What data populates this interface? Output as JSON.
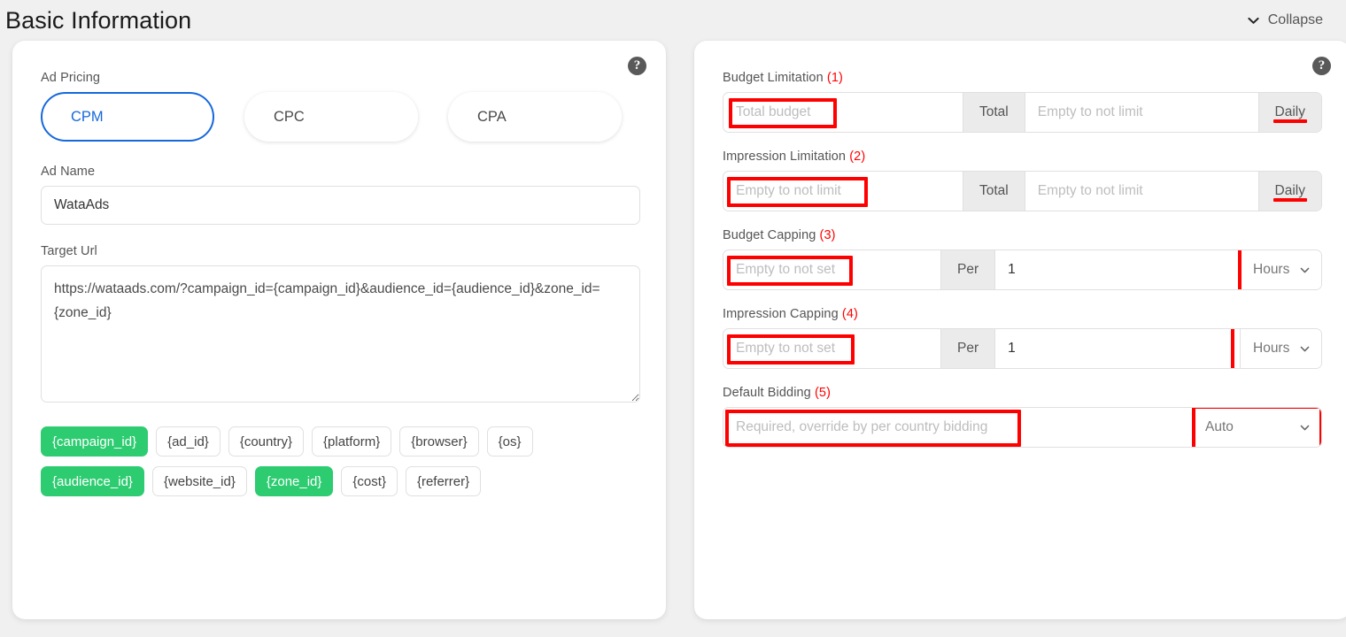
{
  "header": {
    "title": "Basic Information",
    "collapse_label": "Collapse",
    "collapse_icon": "chevron-down-icon"
  },
  "left_panel": {
    "help_icon": "question-mark-icon",
    "help_glyph": "?",
    "ad_pricing": {
      "label": "Ad Pricing",
      "options": [
        {
          "label": "CPM",
          "selected": true
        },
        {
          "label": "CPC",
          "selected": false
        },
        {
          "label": "CPA",
          "selected": false
        }
      ]
    },
    "ad_name": {
      "label": "Ad Name",
      "value": "WataAds",
      "placeholder": "Ad Name"
    },
    "target_url": {
      "label": "Target Url",
      "value": "https://wataads.com/?campaign_id={campaign_id}&audience_id={audience_id}&zone_id={zone_id}",
      "placeholder": "Target Url"
    },
    "macros_row1": [
      {
        "label": "{campaign_id}",
        "active": true
      },
      {
        "label": "{ad_id}",
        "active": false
      },
      {
        "label": "{country}",
        "active": false
      },
      {
        "label": "{platform}",
        "active": false
      },
      {
        "label": "{browser}",
        "active": false
      },
      {
        "label": "{os}",
        "active": false
      }
    ],
    "macros_row2": [
      {
        "label": "{audience_id}",
        "active": true
      },
      {
        "label": "{website_id}",
        "active": false
      },
      {
        "label": "{zone_id}",
        "active": true
      },
      {
        "label": "{cost}",
        "active": false
      },
      {
        "label": "{referrer}",
        "active": false
      }
    ]
  },
  "right_panel": {
    "help_icon": "question-mark-icon",
    "help_glyph": "?",
    "budget_limitation": {
      "label": "Budget Limitation",
      "number": "(1)",
      "total_placeholder": "Total budget",
      "total_value": "",
      "total_addon": "Total",
      "daily_placeholder": "Empty to not limit",
      "daily_value": "",
      "daily_addon": "Daily"
    },
    "impression_limitation": {
      "label": "Impression Limitation",
      "number": "(2)",
      "total_placeholder": "Empty to not limit",
      "total_value": "",
      "total_addon": "Total",
      "daily_placeholder": "Empty to not limit",
      "daily_value": "",
      "daily_addon": "Daily"
    },
    "budget_capping": {
      "label": "Budget Capping",
      "number": "(3)",
      "amount_placeholder": "Empty to not set",
      "amount_value": "",
      "per_addon": "Per",
      "interval_value": "1",
      "interval_placeholder": "1",
      "unit_selected": "Hours"
    },
    "impression_capping": {
      "label": "Impression Capping",
      "number": "(4)",
      "amount_placeholder": "Empty to not set",
      "amount_value": "",
      "per_addon": "Per",
      "interval_value": "1",
      "interval_placeholder": "1",
      "unit_selected": "Hours"
    },
    "default_bidding": {
      "label": "Default Bidding",
      "number": "(5)",
      "bid_placeholder": "Required, override by per country bidding",
      "bid_value": "",
      "mode_selected": "Auto"
    }
  },
  "colors": {
    "accent_blue": "#1668dc",
    "annotation_red": "#ff0000",
    "chip_active_green": "#2ecc71",
    "page_bg": "#f0f0f0",
    "card_bg": "#ffffff"
  }
}
